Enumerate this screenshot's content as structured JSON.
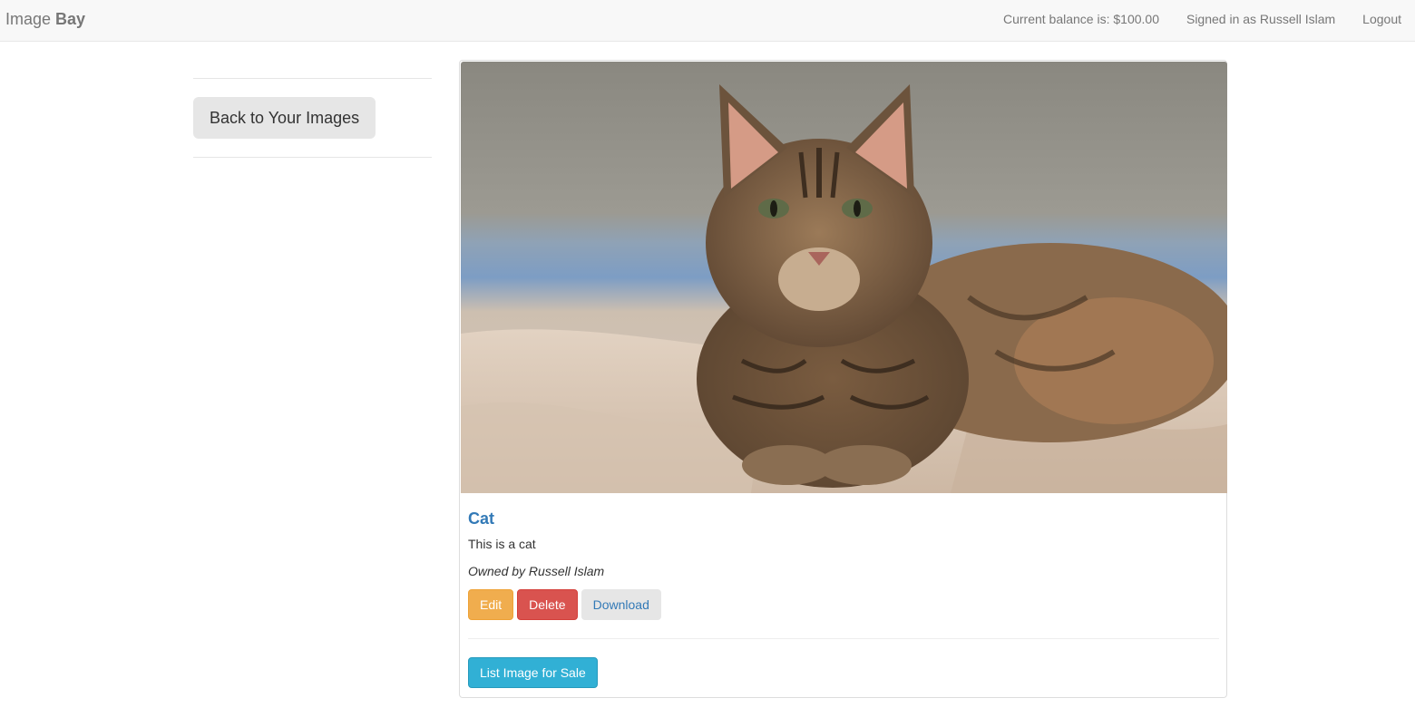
{
  "navbar": {
    "brand_light": "Image",
    "brand_bold": "Bay",
    "balance": "Current balance is: $100.00",
    "signed_in": "Signed in as Russell Islam",
    "logout": "Logout"
  },
  "sidebar": {
    "back_label": "Back to Your Images"
  },
  "image": {
    "title": "Cat",
    "description": "This is a cat",
    "owner": "Owned by Russell Islam",
    "actions": {
      "edit": "Edit",
      "delete": "Delete",
      "download": "Download"
    },
    "sale_label": "List Image for Sale"
  },
  "colors": {
    "link": "#337ab7",
    "edit": "#f0ad4e",
    "delete": "#d9534f",
    "sale": "#31b0d5"
  }
}
